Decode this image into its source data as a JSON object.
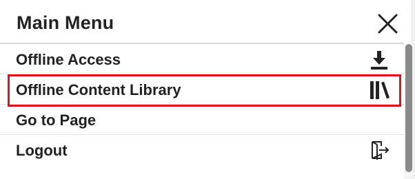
{
  "menu": {
    "title": "Main Menu",
    "close_icon": "close-icon",
    "items": [
      {
        "label": "Offline Access",
        "icon": "download-icon"
      },
      {
        "label": "Offline Content Library",
        "icon": "library-icon",
        "highlighted": true
      },
      {
        "label": "Go to Page",
        "icon": ""
      },
      {
        "label": "Logout",
        "icon": "logout-icon"
      }
    ]
  },
  "colors": {
    "highlight": "#e4111a",
    "text": "#222222",
    "divider": "#e3e3e3",
    "scrollbar_thumb": "#8a8a8a"
  }
}
